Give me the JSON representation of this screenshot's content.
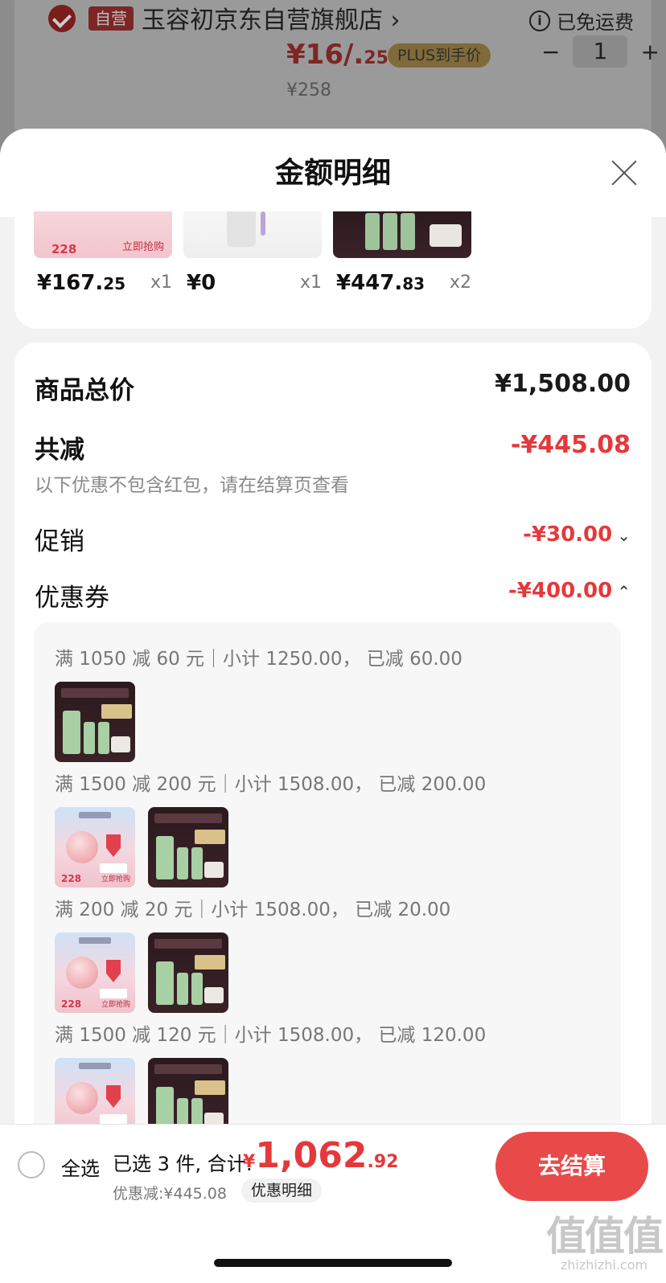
{
  "background": {
    "self_tag": "自营",
    "shop_name": "玉容初京东自营旗舰店",
    "shop_chevron": "›",
    "free_shipping": "已免运费",
    "price_main": "¥16/.",
    "price_dec": "25",
    "plus_label": "PLUS到手价",
    "stepper": {
      "minus": "−",
      "qty": "1",
      "plus": "+"
    },
    "original_price": "¥258"
  },
  "sheet": {
    "title": "金额明细",
    "products": [
      {
        "price_int": "¥167.",
        "price_dec": "25",
        "qty": "x1",
        "thumb": "pink",
        "thumb_num": "228",
        "thumb_cta": "立即抢购"
      },
      {
        "price_int": "¥0",
        "price_dec": "",
        "qty": "x1",
        "thumb": "white"
      },
      {
        "price_int": "¥447.",
        "price_dec": "83",
        "qty": "x2",
        "thumb": "dark"
      }
    ],
    "total_label": "商品总价",
    "total_value": "¥1,508.00",
    "reduce_label": "共减",
    "reduce_value": "-¥445.08",
    "note": "以下优惠不包含红包，请在结算页查看",
    "promo_label": "促销",
    "promo_value": "-¥30.00",
    "coupon_label": "优惠券",
    "coupon_value": "-¥400.00",
    "coupons": [
      {
        "text": "满 1050 减 60 元｜小计 1250.00，  已减 60.00"
      },
      {
        "text": "满 1500 减 200 元｜小计 1508.00，  已减 200.00"
      },
      {
        "text": "满 200 减 20 元｜小计 1508.00，  已减 20.00"
      },
      {
        "text": "满 1500 减 120 元｜小计 1508.00，  已减 120.00"
      }
    ]
  },
  "footer": {
    "select_all": "全选",
    "selected_summary": "已选 3 件, 合计:",
    "total_currency": "¥",
    "total_int": "1,062",
    "total_dec": ".92",
    "discount_text": "优惠减:¥445.08",
    "detail_link": "优惠明细",
    "checkout": "去结算"
  },
  "watermark": {
    "big": "值值值",
    "small": "zhizhizhi.com"
  },
  "colors": {
    "accent_red": "#e4393c",
    "checkout_bg": "#e84a4a"
  }
}
